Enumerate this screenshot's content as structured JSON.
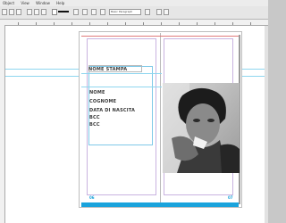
{
  "menubar": {
    "items": [
      "Object",
      "View",
      "Window",
      "Help"
    ]
  },
  "toolbar": {
    "zoom": "Basic Paragraph"
  },
  "document": {
    "header_label": "NOME STAMPA",
    "fields": [
      "NOME",
      "COGNOME",
      "DATA DI NASCITA",
      "BCC",
      "BCC"
    ],
    "page_left": "06",
    "page_right": "07"
  },
  "colors": {
    "accent": "#1aa3dc",
    "guide": "#8fd6ef",
    "margin": "#c9b3e0"
  }
}
